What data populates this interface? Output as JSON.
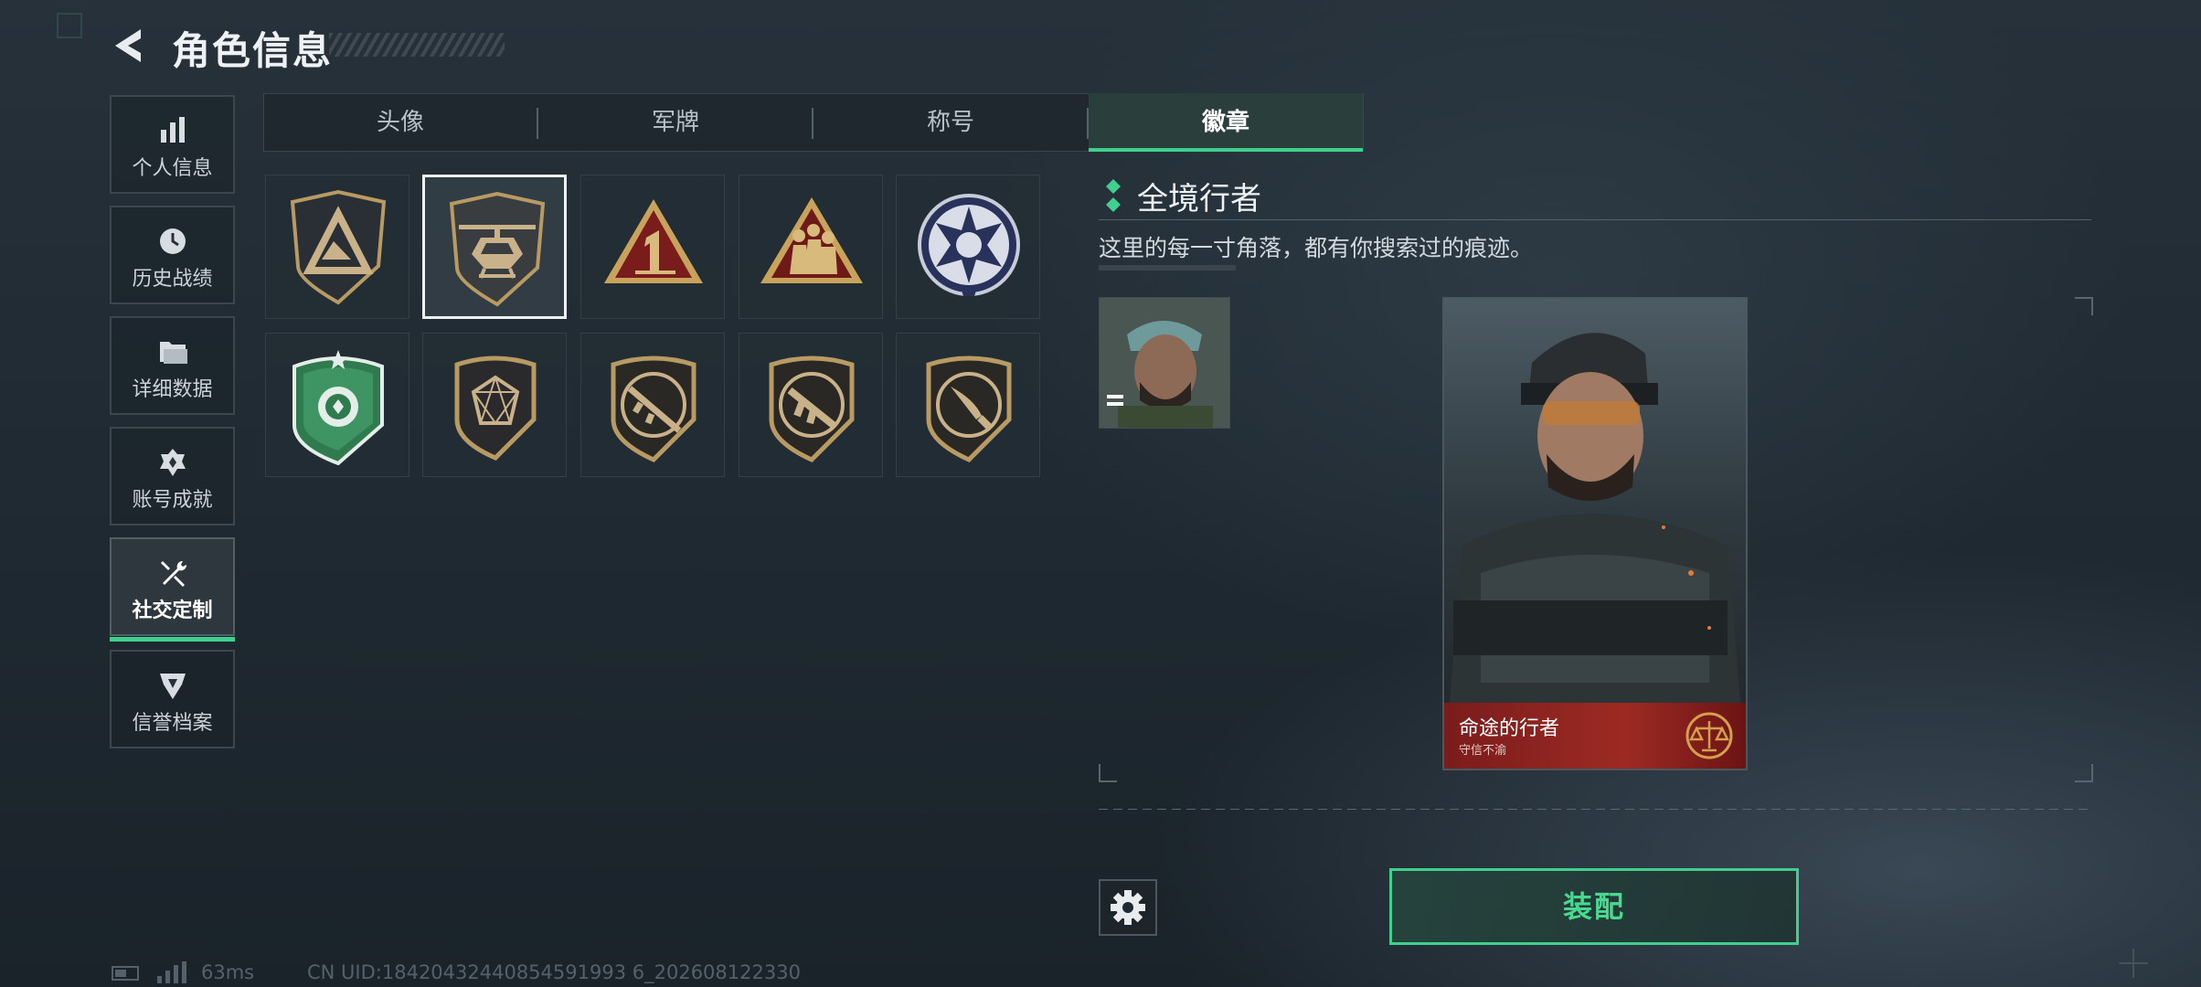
{
  "header": {
    "title": "角色信息"
  },
  "sidebar": {
    "items": [
      {
        "label": "个人信息",
        "icon": "bar-chart-icon"
      },
      {
        "label": "历史战绩",
        "icon": "clock-icon"
      },
      {
        "label": "详细数据",
        "icon": "folder-icon"
      },
      {
        "label": "账号成就",
        "icon": "achievement-icon"
      },
      {
        "label": "社交定制",
        "icon": "wrench-screwdriver-icon",
        "active": true
      },
      {
        "label": "信誉档案",
        "icon": "reputation-icon"
      }
    ]
  },
  "tabs": [
    {
      "label": "头像"
    },
    {
      "label": "军牌"
    },
    {
      "label": "称号"
    },
    {
      "label": "徽章",
      "active": true
    }
  ],
  "badges": [
    {
      "icon": "triangle-shield-badge"
    },
    {
      "icon": "helicopter-badge",
      "selected": true
    },
    {
      "icon": "number-one-badge"
    },
    {
      "icon": "squad-badge"
    },
    {
      "icon": "star-wolf-badge"
    },
    {
      "icon": "green-shield-badge"
    },
    {
      "icon": "crystal-badge"
    },
    {
      "icon": "rifle-badge"
    },
    {
      "icon": "smg-badge"
    },
    {
      "icon": "knife-badge"
    }
  ],
  "detail": {
    "name": "全境行者",
    "description": "这里的每一寸角落，都有你搜索过的痕迹。",
    "card": {
      "name": "命途的行者",
      "subtitle": "守信不渝"
    }
  },
  "actions": {
    "equip_label": "装配"
  },
  "status_bar": {
    "ping": "63ms",
    "uid": "CN UID:18420432440854591993 6_202608122330"
  },
  "colors": {
    "accent": "#3fd08e",
    "card_band": "#9d2a23"
  }
}
